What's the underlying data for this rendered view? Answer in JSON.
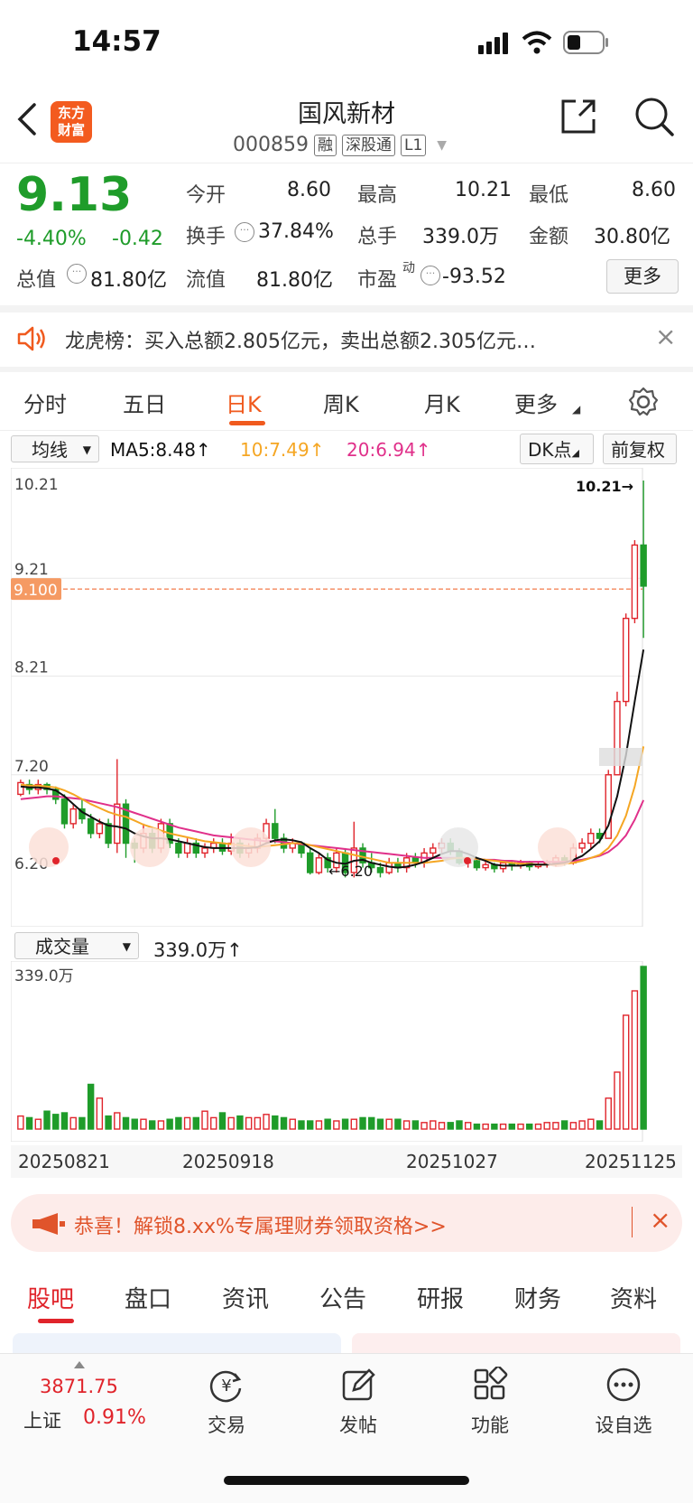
{
  "status": {
    "time": "14:57"
  },
  "header": {
    "logo_line1": "东方",
    "logo_line2": "财富",
    "title": "国风新材",
    "code": "000859",
    "tags": [
      "融",
      "深股通",
      "L1"
    ]
  },
  "quote": {
    "price": "9.13",
    "change_pct": "-4.40%",
    "change_amt": "-0.42",
    "fields": {
      "open_label": "今开",
      "open": "8.60",
      "high_label": "最高",
      "high": "10.21",
      "low_label": "最低",
      "low": "8.60",
      "turnover_label": "换手",
      "turnover": "37.84%",
      "volume_label": "总手",
      "volume": "339.0万",
      "amount_label": "金额",
      "amount": "30.80亿",
      "mktcap_label": "总值",
      "mktcap": "81.80亿",
      "float_label": "流值",
      "float": "81.80亿",
      "pe_label": "市盈",
      "pe_sup": "动",
      "pe": "-93.52"
    },
    "more_label": "更多"
  },
  "banner": {
    "text": "龙虎榜：买入总额2.805亿元，卖出总额2.305亿元…"
  },
  "tabs": [
    "分时",
    "五日",
    "日K",
    "周K",
    "月K",
    "更多"
  ],
  "ma_row": {
    "select": "均线",
    "ma5": "MA5:8.48↑",
    "ma10": "10:7.49↑",
    "ma20": "20:6.94↑",
    "dk": "DK点",
    "adjust": "前复权"
  },
  "colors": {
    "up": "#e0242b",
    "down": "#1f9c2a",
    "ma5": "#111111",
    "ma10": "#f5a623",
    "ma20": "#e0308a",
    "accent": "#f05a1e"
  },
  "chart_data": {
    "type": "candlestick",
    "ylim": [
      6.2,
      10.21
    ],
    "y_ticks": [
      "10.21",
      "9.21",
      "8.21",
      "7.20",
      "6.20"
    ],
    "current_price_label": "9.100",
    "max_label": "10.21→",
    "min_label": "←6.20",
    "candles": [
      [
        7.0,
        7.12,
        6.98,
        7.15
      ],
      [
        7.1,
        7.05,
        7.0,
        7.15
      ],
      [
        7.05,
        7.1,
        7.0,
        7.15
      ],
      [
        7.1,
        7.05,
        7.0,
        7.12
      ],
      [
        7.05,
        6.95,
        6.9,
        7.08
      ],
      [
        6.95,
        6.7,
        6.65,
        7.0
      ],
      [
        6.7,
        6.85,
        6.65,
        6.9
      ],
      [
        6.85,
        6.75,
        6.7,
        6.95
      ],
      [
        6.75,
        6.6,
        6.55,
        6.8
      ],
      [
        6.6,
        6.7,
        6.55,
        6.75
      ],
      [
        6.7,
        6.5,
        6.45,
        6.75
      ],
      [
        6.5,
        6.9,
        6.4,
        7.36
      ],
      [
        6.9,
        6.5,
        6.35,
        6.95
      ],
      [
        6.5,
        6.45,
        6.3,
        6.55
      ],
      [
        6.45,
        6.6,
        6.4,
        6.7
      ],
      [
        6.6,
        6.45,
        6.4,
        6.65
      ],
      [
        6.45,
        6.7,
        6.4,
        6.75
      ],
      [
        6.7,
        6.5,
        6.45,
        6.75
      ],
      [
        6.5,
        6.4,
        6.35,
        6.55
      ],
      [
        6.4,
        6.5,
        6.35,
        6.55
      ],
      [
        6.5,
        6.4,
        6.35,
        6.55
      ],
      [
        6.4,
        6.45,
        6.35,
        6.5
      ],
      [
        6.45,
        6.5,
        6.4,
        6.55
      ],
      [
        6.5,
        6.42,
        6.38,
        6.55
      ],
      [
        6.42,
        6.5,
        6.38,
        6.6
      ],
      [
        6.5,
        6.4,
        6.35,
        6.55
      ],
      [
        6.4,
        6.45,
        6.35,
        6.5
      ],
      [
        6.45,
        6.55,
        6.4,
        6.6
      ],
      [
        6.55,
        6.7,
        6.5,
        6.75
      ],
      [
        6.7,
        6.55,
        6.5,
        6.85
      ],
      [
        6.55,
        6.45,
        6.4,
        6.6
      ],
      [
        6.45,
        6.5,
        6.4,
        6.55
      ],
      [
        6.5,
        6.4,
        6.35,
        6.52
      ],
      [
        6.4,
        6.2,
        6.18,
        6.45
      ],
      [
        6.2,
        6.35,
        6.18,
        6.4
      ],
      [
        6.35,
        6.25,
        6.2,
        6.4
      ],
      [
        6.25,
        6.4,
        6.2,
        6.45
      ],
      [
        6.4,
        6.2,
        6.15,
        6.45
      ],
      [
        6.2,
        6.45,
        6.15,
        6.72
      ],
      [
        6.45,
        6.3,
        6.25,
        6.5
      ],
      [
        6.3,
        6.25,
        6.2,
        6.4
      ],
      [
        6.25,
        6.2,
        6.15,
        6.3
      ],
      [
        6.2,
        6.3,
        6.18,
        6.35
      ],
      [
        6.3,
        6.25,
        6.2,
        6.35
      ],
      [
        6.25,
        6.35,
        6.2,
        6.4
      ],
      [
        6.35,
        6.3,
        6.25,
        6.4
      ],
      [
        6.3,
        6.4,
        6.25,
        6.45
      ],
      [
        6.4,
        6.45,
        6.35,
        6.5
      ],
      [
        6.45,
        6.5,
        6.4,
        6.55
      ],
      [
        6.5,
        6.42,
        6.38,
        6.55
      ],
      [
        6.42,
        6.3,
        6.28,
        6.45
      ],
      [
        6.3,
        6.32,
        6.25,
        6.36
      ],
      [
        6.32,
        6.25,
        6.22,
        6.35
      ],
      [
        6.25,
        6.28,
        6.22,
        6.32
      ],
      [
        6.28,
        6.24,
        6.2,
        6.3
      ],
      [
        6.24,
        6.3,
        6.2,
        6.33
      ],
      [
        6.3,
        6.27,
        6.22,
        6.32
      ],
      [
        6.27,
        6.3,
        6.24,
        6.33
      ],
      [
        6.3,
        6.26,
        6.22,
        6.32
      ],
      [
        6.26,
        6.28,
        6.24,
        6.31
      ],
      [
        6.28,
        6.3,
        6.25,
        6.33
      ],
      [
        6.3,
        6.35,
        6.26,
        6.38
      ],
      [
        6.35,
        6.3,
        6.27,
        6.38
      ],
      [
        6.3,
        6.45,
        6.28,
        6.5
      ],
      [
        6.45,
        6.5,
        6.4,
        6.55
      ],
      [
        6.5,
        6.6,
        6.45,
        6.65
      ],
      [
        6.6,
        6.55,
        6.5,
        6.65
      ],
      [
        6.55,
        7.2,
        6.55,
        7.25
      ],
      [
        7.2,
        7.95,
        7.2,
        8.05
      ],
      [
        7.95,
        8.8,
        7.9,
        8.85
      ],
      [
        8.8,
        9.55,
        8.75,
        9.6
      ],
      [
        9.55,
        9.13,
        8.6,
        10.21
      ]
    ],
    "ma5": [
      7.08,
      7.07,
      7.07,
      7.06,
      7.04,
      6.98,
      6.9,
      6.82,
      6.77,
      6.72,
      6.68,
      6.67,
      6.65,
      6.6,
      6.57,
      6.55,
      6.55,
      6.54,
      6.52,
      6.5,
      6.48,
      6.46,
      6.45,
      6.45,
      6.45,
      6.45,
      6.45,
      6.46,
      6.5,
      6.53,
      6.54,
      6.53,
      6.51,
      6.45,
      6.4,
      6.33,
      6.3,
      6.29,
      6.32,
      6.33,
      6.3,
      6.28,
      6.26,
      6.25,
      6.26,
      6.28,
      6.31,
      6.35,
      6.39,
      6.42,
      6.42,
      6.39,
      6.35,
      6.32,
      6.28,
      6.27,
      6.27,
      6.27,
      6.28,
      6.28,
      6.28,
      6.29,
      6.3,
      6.33,
      6.37,
      6.44,
      6.52,
      6.68,
      6.98,
      7.4,
      7.95,
      8.48
    ],
    "ma10": [
      7.1,
      7.09,
      7.09,
      7.08,
      7.07,
      7.04,
      7.0,
      6.95,
      6.9,
      6.86,
      6.82,
      6.79,
      6.77,
      6.73,
      6.69,
      6.66,
      6.63,
      6.6,
      6.58,
      6.56,
      6.54,
      6.52,
      6.51,
      6.5,
      6.49,
      6.48,
      6.47,
      6.46,
      6.47,
      6.48,
      6.49,
      6.5,
      6.5,
      6.48,
      6.46,
      6.44,
      6.42,
      6.4,
      6.38,
      6.36,
      6.34,
      6.32,
      6.3,
      6.3,
      6.3,
      6.3,
      6.3,
      6.31,
      6.32,
      6.34,
      6.35,
      6.35,
      6.34,
      6.33,
      6.32,
      6.31,
      6.3,
      6.29,
      6.29,
      6.28,
      6.28,
      6.28,
      6.29,
      6.3,
      6.32,
      6.35,
      6.38,
      6.45,
      6.58,
      6.78,
      7.08,
      7.49
    ],
    "ma20": [
      6.95,
      6.96,
      6.97,
      6.98,
      6.98,
      6.97,
      6.96,
      6.95,
      6.93,
      6.91,
      6.89,
      6.87,
      6.84,
      6.81,
      6.78,
      6.75,
      6.72,
      6.69,
      6.66,
      6.64,
      6.62,
      6.6,
      6.58,
      6.57,
      6.56,
      6.55,
      6.54,
      6.53,
      6.52,
      6.52,
      6.51,
      6.5,
      6.49,
      6.48,
      6.47,
      6.46,
      6.45,
      6.44,
      6.43,
      6.42,
      6.41,
      6.4,
      6.39,
      6.38,
      6.37,
      6.36,
      6.35,
      6.35,
      6.35,
      6.35,
      6.35,
      6.34,
      6.34,
      6.33,
      6.33,
      6.32,
      6.32,
      6.31,
      6.31,
      6.31,
      6.31,
      6.31,
      6.31,
      6.32,
      6.33,
      6.35,
      6.37,
      6.41,
      6.48,
      6.58,
      6.74,
      6.94
    ],
    "volume_max_label": "339.0万",
    "volumes": [
      16,
      14,
      12,
      22,
      18,
      20,
      14,
      14,
      55,
      38,
      16,
      20,
      14,
      12,
      12,
      10,
      10,
      12,
      14,
      14,
      14,
      22,
      14,
      20,
      14,
      16,
      14,
      14,
      18,
      16,
      14,
      12,
      10,
      10,
      10,
      12,
      10,
      12,
      12,
      14,
      14,
      12,
      12,
      12,
      10,
      10,
      8,
      10,
      8,
      8,
      10,
      8,
      6,
      6,
      6,
      6,
      6,
      6,
      6,
      6,
      8,
      8,
      10,
      8,
      10,
      12,
      10,
      38,
      70,
      140,
      170,
      200
    ],
    "x_labels": [
      "20250821",
      "20250918",
      "20251027",
      "20251125"
    ]
  },
  "volume_row": {
    "select": "成交量",
    "value": "339.0万↑"
  },
  "promo": {
    "text": "恭喜！解锁8.xx%专属理财券领取资格>>"
  },
  "bottom_tabs": [
    "股吧",
    "盘口",
    "资讯",
    "公告",
    "研报",
    "财务",
    "资料"
  ],
  "dock": {
    "index_value": "3871.75",
    "index_name": "上证",
    "index_change": "0.91%",
    "items": [
      "交易",
      "发帖",
      "功能",
      "设自选"
    ]
  }
}
